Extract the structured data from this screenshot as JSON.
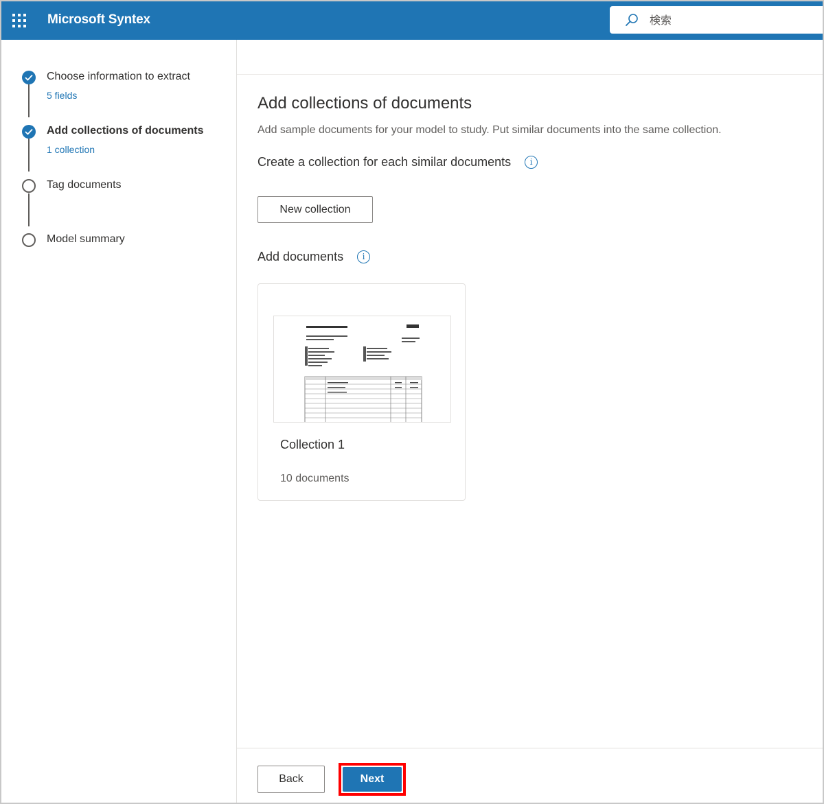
{
  "app": {
    "name": "Microsoft Syntex",
    "search_placeholder": "検索",
    "icons": {
      "app_launcher": "waffle-grid-icon",
      "search": "search-icon"
    },
    "colors": {
      "brand": "#1f75b4",
      "highlight": "#ff0000"
    }
  },
  "steps": [
    {
      "title": "Choose information to extract",
      "sub": "5 fields",
      "state": "done"
    },
    {
      "title": "Add collections of documents",
      "sub": "1 collection",
      "state": "current"
    },
    {
      "title": "Tag documents",
      "sub": "",
      "state": "todo"
    },
    {
      "title": "Model summary",
      "sub": "",
      "state": "todo"
    }
  ],
  "main": {
    "title": "Add collections of documents",
    "description": "Add sample documents for your model to study. Put similar documents into the same collection.",
    "create_section": "Create a collection for each similar documents",
    "new_collection_label": "New collection",
    "add_docs_section": "Add documents",
    "collections": [
      {
        "name": "Collection 1",
        "count": "10 documents"
      }
    ]
  },
  "footer": {
    "back_label": "Back",
    "next_label": "Next"
  }
}
